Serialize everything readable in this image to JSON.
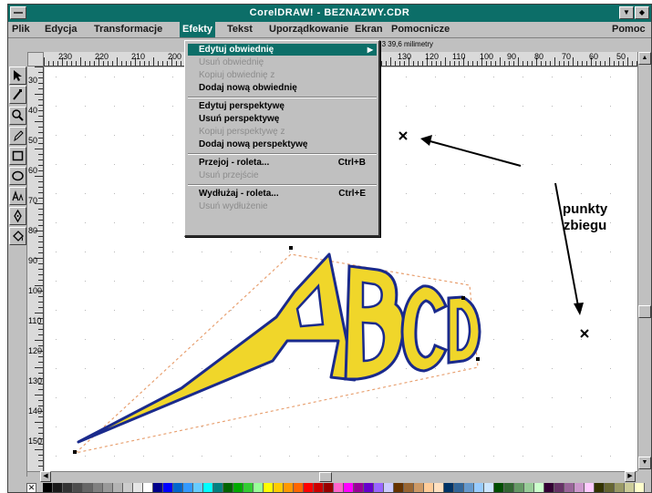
{
  "window": {
    "title": "CorelDRAW! - BEZNAZWY.CDR"
  },
  "menu_bar": {
    "items": [
      "Plik",
      "Edycja",
      "Transformacje",
      "Efekty",
      "Tekst",
      "Uporządkowanie",
      "Ekran",
      "Pomocnicze",
      "Pomoc"
    ],
    "active": "Efekty"
  },
  "status": {
    "coords": "129,3  39,6  milimetry"
  },
  "effects_menu": {
    "items": [
      {
        "label": "Edytuj obwiednię",
        "state": "highlighted",
        "submenu": true
      },
      {
        "label": "Usuń obwiednię",
        "state": "disabled"
      },
      {
        "label": "Kopiuj obwiednię z",
        "state": "disabled"
      },
      {
        "label": "Dodaj nową obwiednię",
        "state": "enabled"
      },
      {
        "separator": true
      },
      {
        "label": "Edytuj perspektywę",
        "state": "enabled"
      },
      {
        "label": "Usuń perspektywę",
        "state": "enabled"
      },
      {
        "label": "Kopiuj perspektywę z",
        "state": "disabled"
      },
      {
        "label": "Dodaj nową perspektywę",
        "state": "enabled"
      },
      {
        "separator": true
      },
      {
        "label": "Przejoj - roleta...",
        "shortcut": "Ctrl+B",
        "state": "enabled"
      },
      {
        "label": "Usuń przejście",
        "state": "disabled"
      },
      {
        "separator": true
      },
      {
        "label": "Wydłużaj - roleta...",
        "shortcut": "Ctrl+E",
        "state": "enabled"
      },
      {
        "label": "Usuń wydłużenie",
        "state": "disabled"
      }
    ]
  },
  "rulers": {
    "horizontal_labels": [
      "230",
      "220",
      "210",
      "200",
      "130",
      "120",
      "110",
      "100",
      "90",
      "80",
      "70",
      "60",
      "50"
    ],
    "vertical_labels": [
      "30",
      "40",
      "50",
      "60",
      "70",
      "80",
      "90",
      "100",
      "110",
      "120",
      "130",
      "140",
      "150"
    ]
  },
  "canvas": {
    "artwork_text": "ABCD",
    "fill_color": "#f0d62a",
    "outline_color": "#1a2a8c",
    "guide_color": "#e8a070"
  },
  "annotation": {
    "line1": "punkty",
    "line2": "zbiegu"
  },
  "colors": {
    "title_bar": "#0c6e68",
    "menu_highlight": "#0c6e68",
    "chrome": "#c0c0c0"
  },
  "toolbox": {
    "tools": [
      "pick-tool",
      "shape-tool",
      "zoom-tool",
      "pencil-tool",
      "rectangle-tool",
      "ellipse-tool",
      "text-tool",
      "outline-tool",
      "fill-tool"
    ]
  },
  "palette": {
    "colors": [
      "#000000",
      "#1a1a1a",
      "#333333",
      "#4d4d4d",
      "#666666",
      "#808080",
      "#999999",
      "#b3b3b3",
      "#cccccc",
      "#e6e6e6",
      "#ffffff",
      "#00008b",
      "#0000ff",
      "#0066cc",
      "#3399ff",
      "#66ccff",
      "#00ffff",
      "#008080",
      "#006400",
      "#00aa00",
      "#33cc33",
      "#99ff99",
      "#ffff00",
      "#ffcc00",
      "#ff9900",
      "#ff6600",
      "#ff0000",
      "#cc0000",
      "#990000",
      "#ff66cc",
      "#ff00ff",
      "#990099",
      "#6600cc",
      "#9966ff",
      "#ccccff",
      "#663300",
      "#996633",
      "#cc9966",
      "#ffcc99",
      "#ffe0c0",
      "#003366",
      "#336699",
      "#6699cc",
      "#99ccff",
      "#cce6ff",
      "#004d00",
      "#336633",
      "#669966",
      "#99cc99",
      "#ccffcc",
      "#330033",
      "#663366",
      "#996699",
      "#cc99cc",
      "#ffccff",
      "#333300",
      "#666633",
      "#999966",
      "#cccc99",
      "#ffffcc"
    ]
  }
}
